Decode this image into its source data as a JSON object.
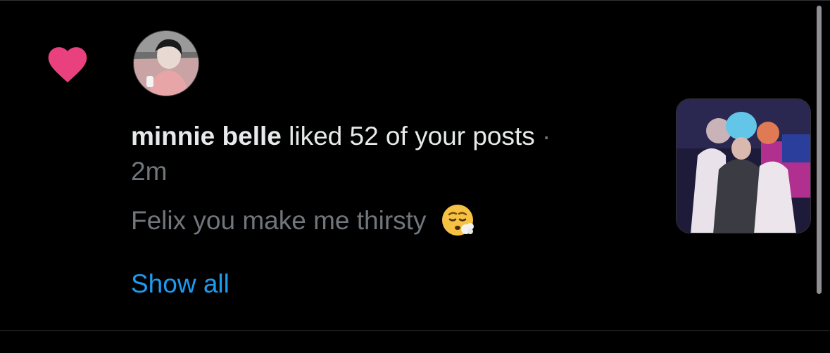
{
  "notification": {
    "type_icon": "heart-icon",
    "accent_color": "#f91880",
    "avatar_icon": "user-avatar",
    "actor_name": "minnie belle",
    "action_text": " liked 52 of your posts",
    "separator": " ·",
    "timestamp": "2m",
    "post_text": "Felix you make me thirsty",
    "post_emoji": "face-exhaling-emoji",
    "show_all_label": "Show all",
    "link_color": "#1d9bf0",
    "thumbnail_icon": "post-media-thumbnail"
  }
}
